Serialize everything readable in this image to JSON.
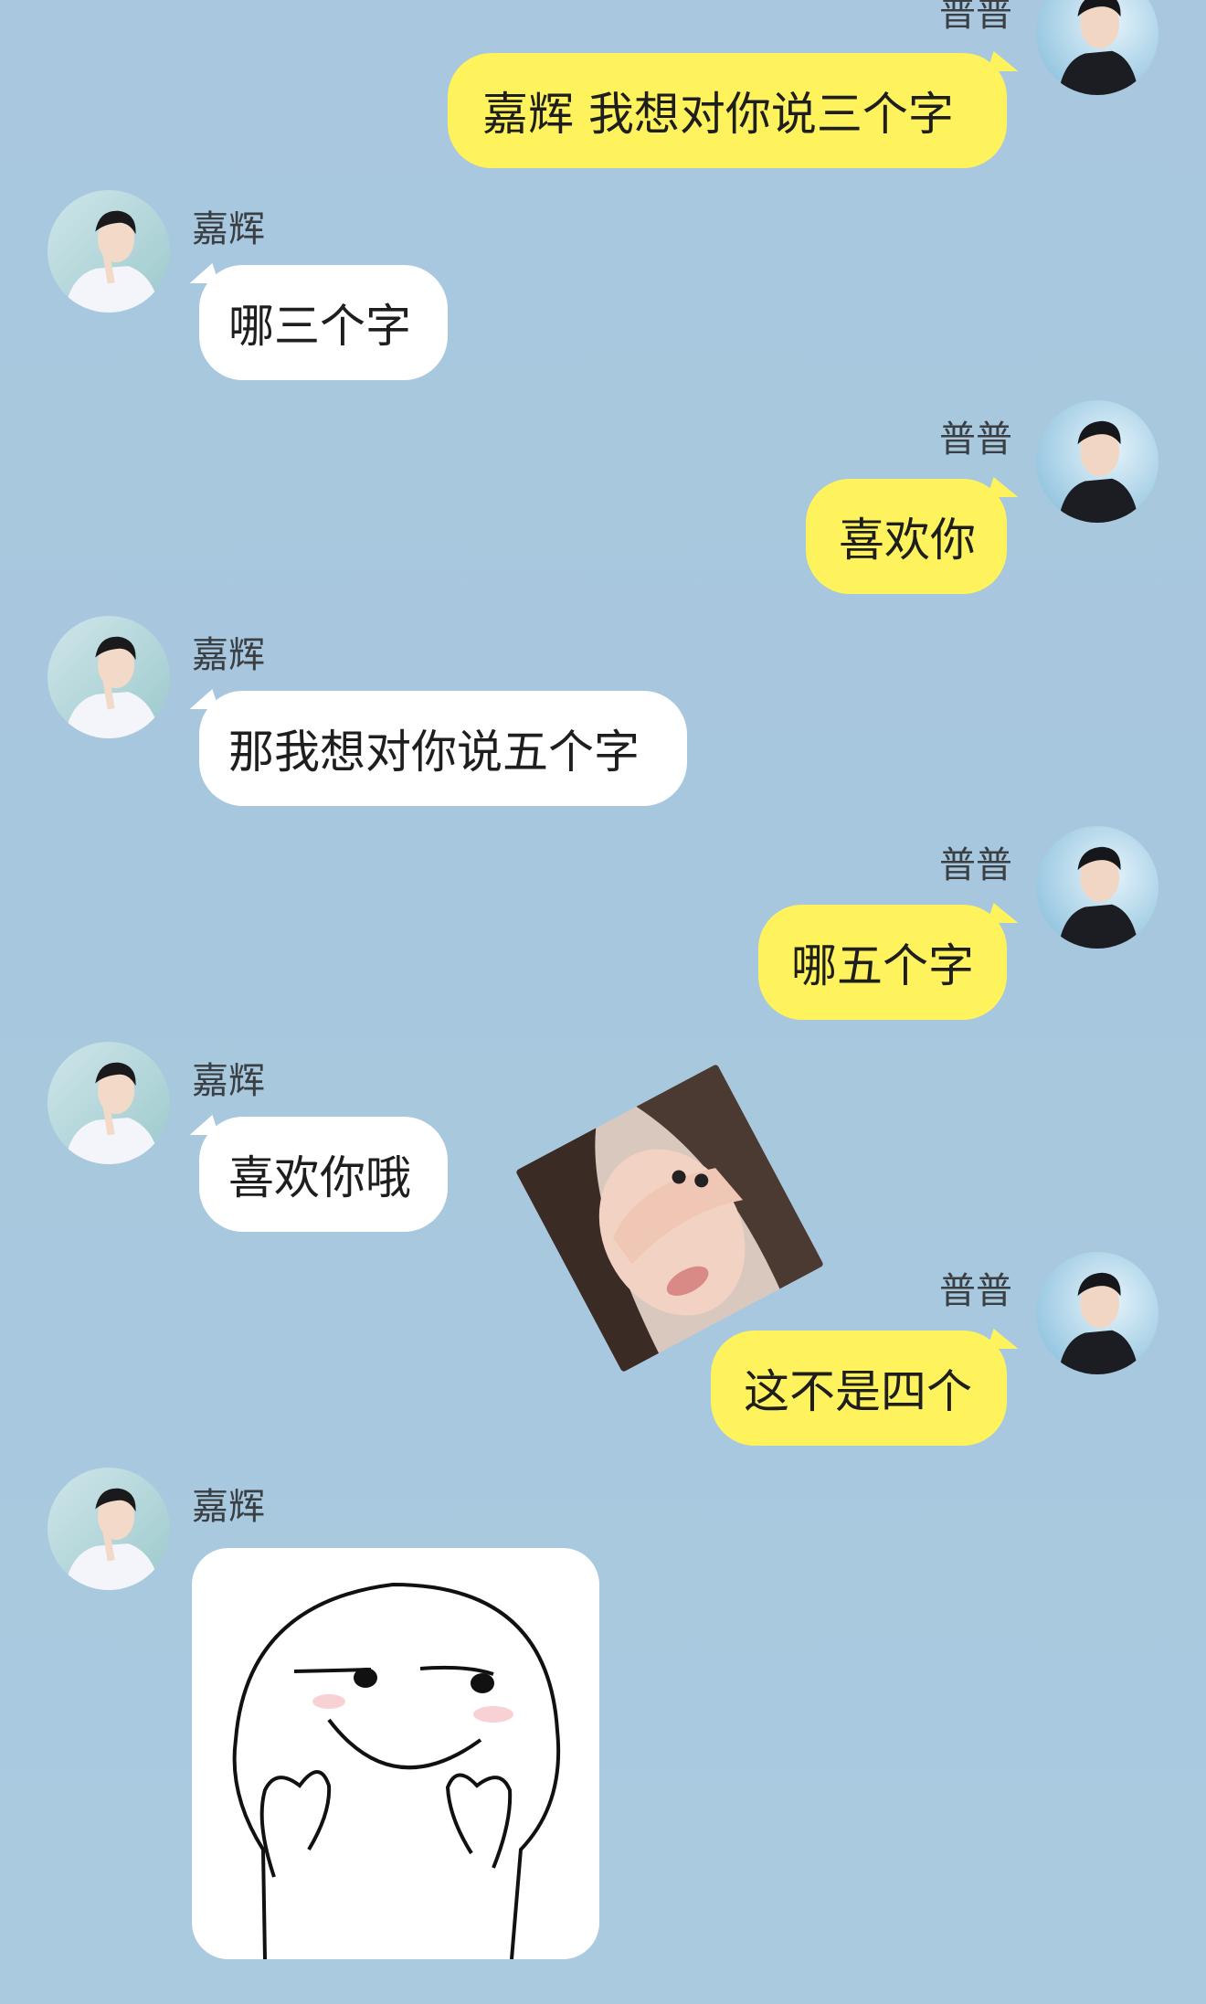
{
  "users": {
    "me": {
      "name": "普普",
      "avatar_icon": "man-profile-avatar"
    },
    "other": {
      "name": "嘉辉",
      "avatar_icon": "man-thinking-avatar"
    }
  },
  "messages": [
    {
      "from": "me",
      "text": "嘉辉  我想对你说三个字"
    },
    {
      "from": "other",
      "text": "哪三个字"
    },
    {
      "from": "me",
      "text": "喜欢你"
    },
    {
      "from": "other",
      "text": "那我想对你说五个字"
    },
    {
      "from": "me",
      "text": "哪五个字"
    },
    {
      "from": "other",
      "text": "喜欢你哦"
    },
    {
      "from": "me",
      "text": "这不是四个"
    },
    {
      "from": "other",
      "sticker": "smug-face-sticker"
    }
  ],
  "decor": {
    "photo_sticker": "girl-covering-eyes-sticker"
  },
  "colors": {
    "background": "#a9c8df",
    "my_bubble": "#fef35c",
    "their_bubble": "#ffffff"
  }
}
